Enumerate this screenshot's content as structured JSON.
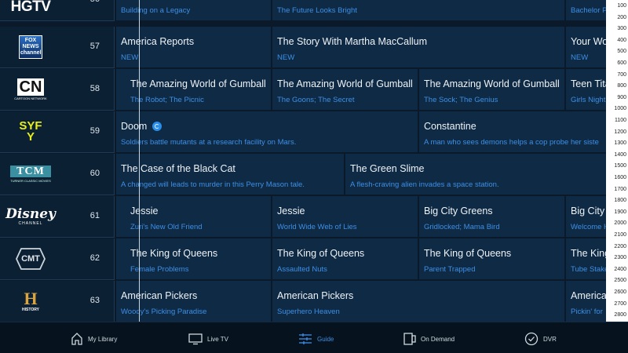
{
  "channels": [
    {
      "number": "56",
      "logo": "HGTV"
    },
    {
      "number": "57",
      "logo": "FOX NEWS channel"
    },
    {
      "number": "58",
      "logo": "CN",
      "logo_sub": "CARTOON NETWORK"
    },
    {
      "number": "59",
      "logo": "SYFY"
    },
    {
      "number": "60",
      "logo": "TCM",
      "logo_sub": "TURNER CLASSIC MOVIES"
    },
    {
      "number": "61",
      "logo": "Disney",
      "logo_sub": "CHANNEL"
    },
    {
      "number": "62",
      "logo": "CMT"
    },
    {
      "number": "63",
      "logo": "H",
      "logo_sub": "HISTORY"
    }
  ],
  "programs": {
    "r56": [
      {
        "title": "",
        "sub": "Building on a Legacy"
      },
      {
        "title": "",
        "sub": "The Future Looks Bright"
      },
      {
        "title": "",
        "sub": "Bachelor Pa"
      }
    ],
    "r57": [
      {
        "title": "America Reports",
        "sub": "NEW"
      },
      {
        "title": "The Story With Martha MacCallum",
        "sub": "NEW"
      },
      {
        "title": "Your Worl",
        "sub": "NEW"
      }
    ],
    "r58": [
      {
        "title": "The Amazing World of Gumball",
        "sub": "The Robot; The Picnic"
      },
      {
        "title": "The Amazing World of Gumball",
        "sub": "The Goons; The Secret"
      },
      {
        "title": "The Amazing World of Gumball",
        "sub": "The Sock; The Genius"
      },
      {
        "title": "Teen Titan",
        "sub": "Girls Night"
      }
    ],
    "r59": [
      {
        "title": "Doom",
        "sub": "Soldiers battle mutants at a research facility on Mars."
      },
      {
        "title": "Constantine",
        "sub": "A man who sees demons helps a cop probe her siste"
      }
    ],
    "r60": [
      {
        "title": "The Case of the Black Cat",
        "sub": "A changed will leads to murder in this Perry Mason tale."
      },
      {
        "title": "The Green Slime",
        "sub": "A flesh-craving alien invades a space station."
      }
    ],
    "r61": [
      {
        "title": "Jessie",
        "sub": "Zuri's New Old Friend"
      },
      {
        "title": "Jessie",
        "sub": "World Wide Web of Lies"
      },
      {
        "title": "Big City Greens",
        "sub": "Gridlocked; Mama Bird"
      },
      {
        "title": "Big City G",
        "sub": "Welcome H"
      }
    ],
    "r62": [
      {
        "title": "The King of Queens",
        "sub": "Female Problems"
      },
      {
        "title": "The King of Queens",
        "sub": "Assaulted Nuts"
      },
      {
        "title": "The King of Queens",
        "sub": "Parent Trapped"
      },
      {
        "title": "The King o",
        "sub": "Tube Stake"
      }
    ],
    "r63": [
      {
        "title": "American Pickers",
        "sub": "Woody's Picking Paradise"
      },
      {
        "title": "American Pickers",
        "sub": "Superhero Heaven"
      },
      {
        "title": "American",
        "sub": "Pickin' for"
      }
    ]
  },
  "scale_ticks": [
    "100",
    "200",
    "300",
    "400",
    "500",
    "600",
    "700",
    "800",
    "900",
    "1000",
    "1100",
    "1200",
    "1300",
    "1400",
    "1500",
    "1600",
    "1700",
    "1800",
    "1900",
    "2000",
    "2100",
    "2200",
    "2300",
    "2400",
    "2500",
    "2600",
    "2700",
    "2800"
  ],
  "nav": {
    "my_library": "My Library",
    "live_tv": "Live TV",
    "guide": "Guide",
    "on_demand": "On Demand",
    "dvr": "DVR"
  },
  "colors": {
    "accent": "#3d8fe6",
    "cell_bg": "#0f2a44",
    "channel_bg": "#0c2033",
    "background": "#0a1a2a"
  }
}
